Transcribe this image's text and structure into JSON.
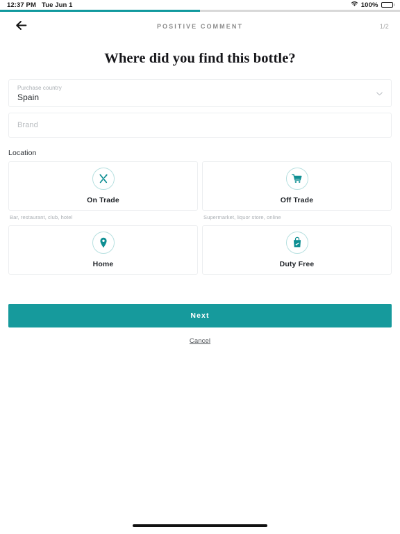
{
  "status_bar": {
    "time": "12:37 PM",
    "date": "Tue Jun 1",
    "battery_percent": "100%",
    "wifi_icon": "wifi-icon",
    "battery_icon": "battery-icon"
  },
  "progress": {
    "percent": 50
  },
  "nav": {
    "back_icon": "arrow-left-icon",
    "title": "POSITIVE COMMENT",
    "step_counter": "1/2"
  },
  "page_title": "Where did you find this bottle?",
  "form": {
    "country": {
      "label": "Purchase country",
      "value": "Spain",
      "caret_icon": "chevron-down-icon"
    },
    "brand": {
      "placeholder": "Brand",
      "value": ""
    }
  },
  "location": {
    "section_label": "Location",
    "options": [
      {
        "label": "On Trade",
        "hint": "Bar, restaurant, club, hotel",
        "icon": "cutlery-icon"
      },
      {
        "label": "Off Trade",
        "hint": "Supermarket, liquor store, online",
        "icon": "shopping-cart-icon"
      },
      {
        "label": "Home",
        "hint": "",
        "icon": "map-pin-icon"
      },
      {
        "label": "Duty Free",
        "hint": "",
        "icon": "duty-free-bag-icon"
      }
    ]
  },
  "actions": {
    "next_label": "Next",
    "cancel_label": "Cancel"
  },
  "colors": {
    "accent": "#169a9c",
    "progress_fill": "#11999e",
    "icon_ring": "#b7e0e0",
    "border": "#eceef0"
  }
}
